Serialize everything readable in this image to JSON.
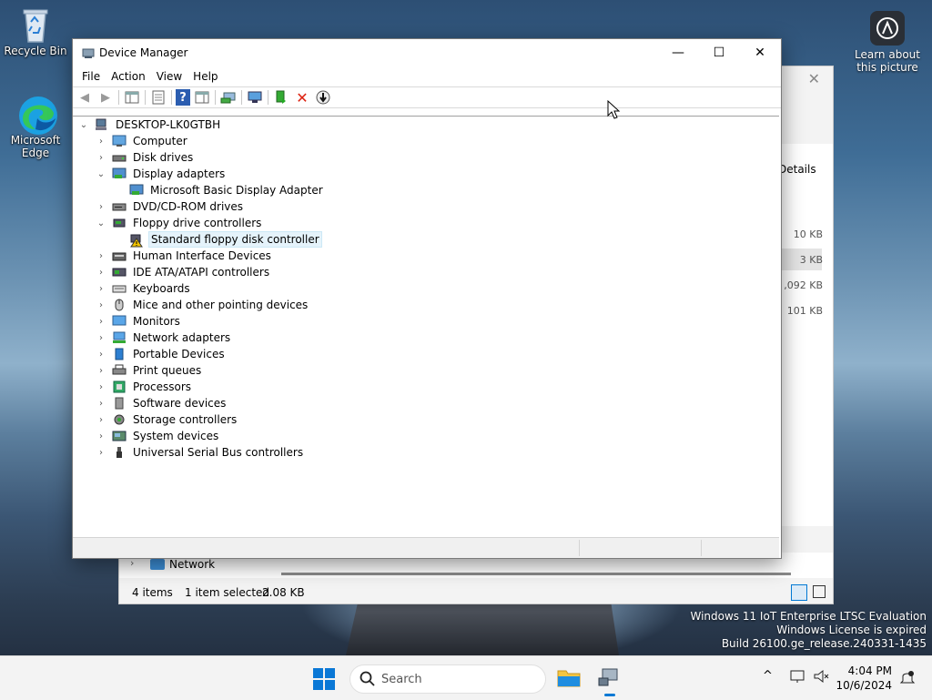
{
  "desktop": {
    "icons": [
      {
        "label": "Recycle Bin"
      },
      {
        "label": "Microsoft Edge"
      }
    ],
    "learn_picture": "Learn about this picture"
  },
  "background_window": {
    "details_label": "Details",
    "sizes": [
      "10 KB",
      "3 KB",
      ",092 KB",
      "101 KB"
    ],
    "nav_item": "Network",
    "status_items": "4 items",
    "status_selected": "1 item selected",
    "status_size": "2.08 KB"
  },
  "device_manager": {
    "title": "Device Manager",
    "window_buttons": {
      "minimize": "—",
      "maximize": "☐",
      "close": "✕"
    },
    "menu": [
      "File",
      "Action",
      "View",
      "Help"
    ],
    "root": "DESKTOP-LK0GTBH",
    "tree": [
      {
        "label": "Computer",
        "expanded": false,
        "icon": "computer-icon"
      },
      {
        "label": "Disk drives",
        "expanded": false,
        "icon": "disk-drive-icon"
      },
      {
        "label": "Display adapters",
        "expanded": true,
        "icon": "display-adapter-icon",
        "children": [
          {
            "label": "Microsoft Basic Display Adapter",
            "icon": "display-adapter-icon"
          }
        ]
      },
      {
        "label": "DVD/CD-ROM drives",
        "expanded": false,
        "icon": "dvd-drive-icon"
      },
      {
        "label": "Floppy drive controllers",
        "expanded": true,
        "icon": "floppy-controller-icon",
        "children": [
          {
            "label": "Standard floppy disk controller",
            "icon": "warning-device-icon",
            "selected": true
          }
        ]
      },
      {
        "label": "Human Interface Devices",
        "expanded": false,
        "icon": "hid-icon"
      },
      {
        "label": "IDE ATA/ATAPI controllers",
        "expanded": false,
        "icon": "ide-controller-icon"
      },
      {
        "label": "Keyboards",
        "expanded": false,
        "icon": "keyboard-icon"
      },
      {
        "label": "Mice and other pointing devices",
        "expanded": false,
        "icon": "mouse-icon"
      },
      {
        "label": "Monitors",
        "expanded": false,
        "icon": "monitor-icon"
      },
      {
        "label": "Network adapters",
        "expanded": false,
        "icon": "network-adapter-icon"
      },
      {
        "label": "Portable Devices",
        "expanded": false,
        "icon": "portable-device-icon"
      },
      {
        "label": "Print queues",
        "expanded": false,
        "icon": "printer-icon"
      },
      {
        "label": "Processors",
        "expanded": false,
        "icon": "processor-icon"
      },
      {
        "label": "Software devices",
        "expanded": false,
        "icon": "software-device-icon"
      },
      {
        "label": "Storage controllers",
        "expanded": false,
        "icon": "storage-controller-icon"
      },
      {
        "label": "System devices",
        "expanded": false,
        "icon": "system-device-icon"
      },
      {
        "label": "Universal Serial Bus controllers",
        "expanded": false,
        "icon": "usb-icon"
      }
    ]
  },
  "taskbar": {
    "search_placeholder": "Search",
    "time": "4:04 PM",
    "date": "10/6/2024"
  },
  "watermark": [
    "Windows 11 IoT Enterprise LTSC Evaluation",
    "Windows License is expired",
    "Build 26100.ge_release.240331-1435"
  ],
  "colors": {
    "accent": "#0078d4",
    "selection": "#e5f3fb",
    "folder": "#f4c542"
  }
}
